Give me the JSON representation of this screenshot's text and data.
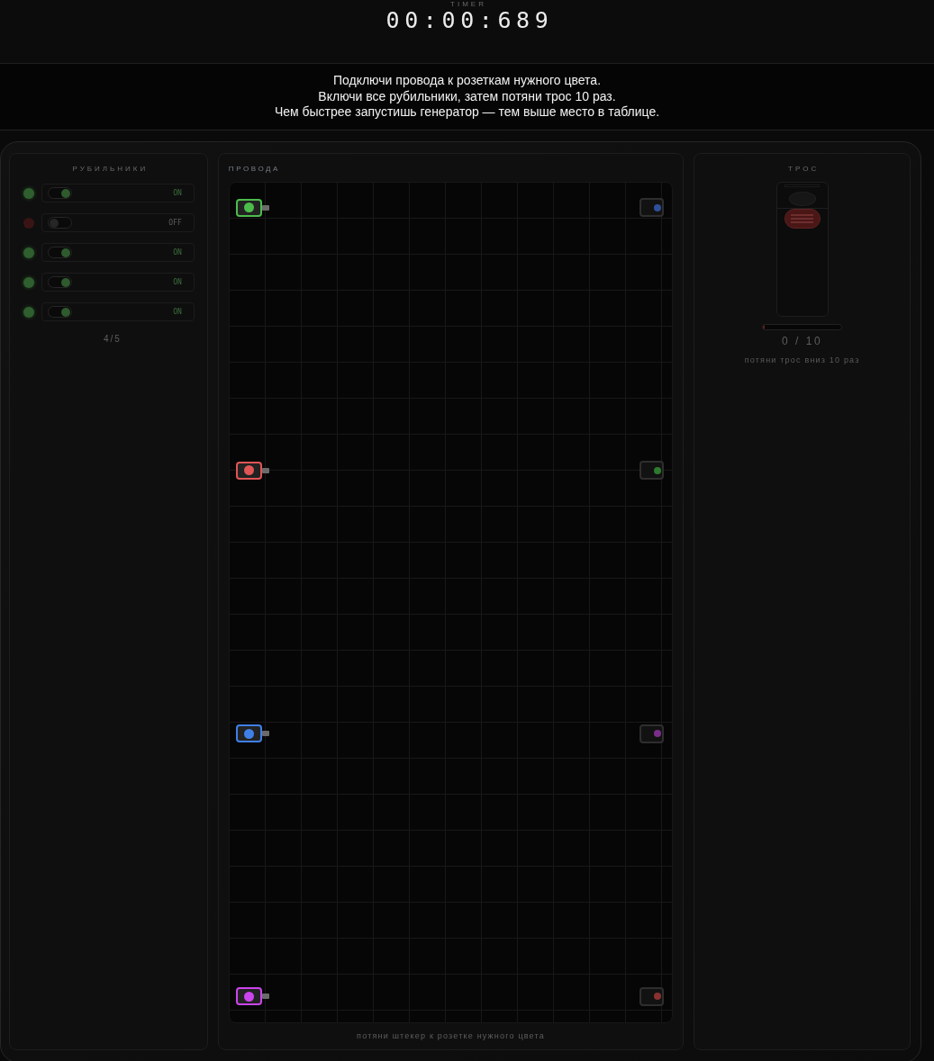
{
  "header": {
    "label": "TIMER",
    "timer": "00:00:689"
  },
  "instructions": [
    "Подключи провода к розеткам нужного цвета.",
    "Включи все рубильники, затем потяни трос 10 раз.",
    "Чем быстрее запустишь генератор — тем выше место в таблице."
  ],
  "switches_panel": {
    "title": "РУБИЛЬНИКИ",
    "switches": [
      {
        "on": true,
        "label": "ON"
      },
      {
        "on": false,
        "label": "OFF"
      },
      {
        "on": true,
        "label": "ON"
      },
      {
        "on": true,
        "label": "ON"
      },
      {
        "on": true,
        "label": "ON"
      }
    ],
    "count": "4/5"
  },
  "wires_panel": {
    "title": "ПРОВОДА",
    "plugs": [
      {
        "color": "#4cbb4c"
      },
      {
        "color": "#e05555"
      },
      {
        "color": "#3f80e8"
      },
      {
        "color": "#cc44ee"
      }
    ],
    "sockets": [
      {
        "color": "#2e4f9a"
      },
      {
        "color": "#2e7a2e"
      },
      {
        "color": "#7a2e8a"
      },
      {
        "color": "#8a3030"
      }
    ],
    "hint": "потяни штекер к розетке нужного цвета"
  },
  "rope_panel": {
    "title": "ТРОС",
    "progress": {
      "level": 0
    },
    "counter": "0 / 10",
    "hint": "потяни трос вниз 10 раз"
  }
}
